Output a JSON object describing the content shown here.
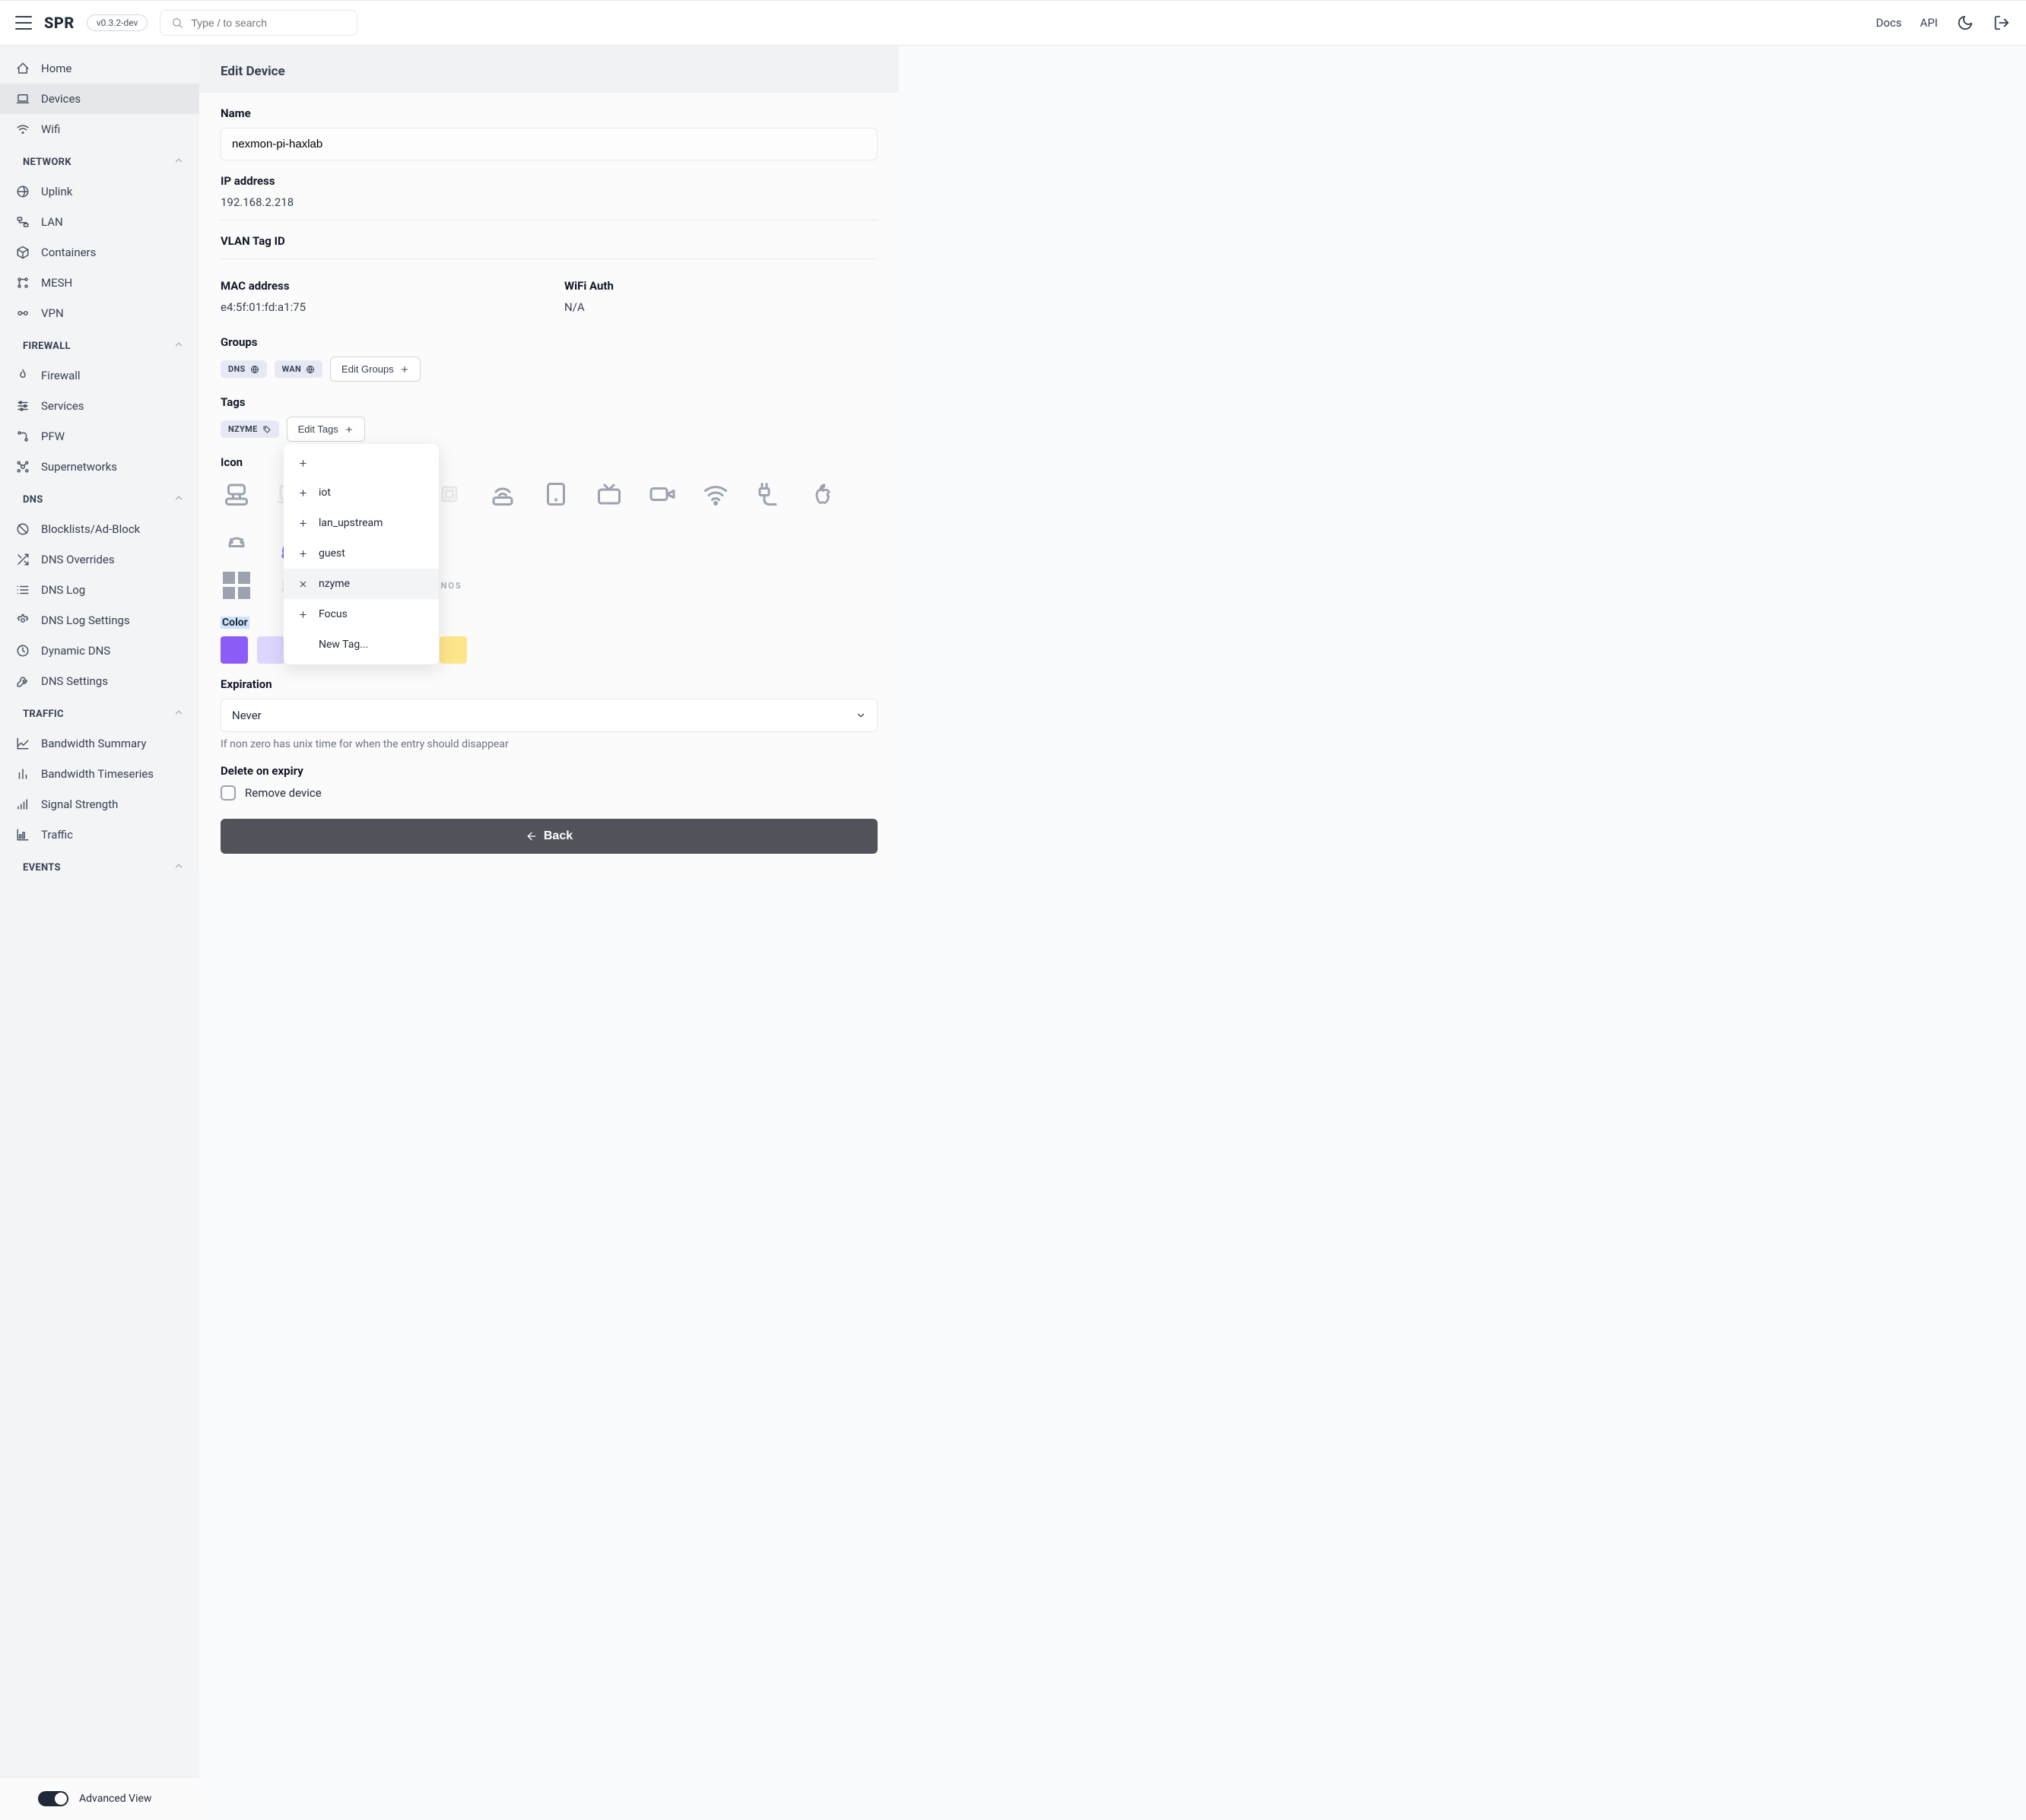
{
  "header": {
    "logo": "SPR",
    "version": "v0.3.2-dev",
    "search_placeholder": "Type / to search",
    "links": {
      "docs": "Docs",
      "api": "API"
    }
  },
  "sidebar": {
    "items_top": [
      {
        "label": "Home",
        "icon": "home"
      },
      {
        "label": "Devices",
        "icon": "laptop",
        "active": true
      },
      {
        "label": "Wifi",
        "icon": "wifi"
      }
    ],
    "sections": [
      {
        "title": "NETWORK",
        "items": [
          {
            "label": "Uplink",
            "icon": "globe"
          },
          {
            "label": "LAN",
            "icon": "lan"
          },
          {
            "label": "Containers",
            "icon": "box"
          },
          {
            "label": "MESH",
            "icon": "mesh"
          },
          {
            "label": "VPN",
            "icon": "vpn"
          }
        ]
      },
      {
        "title": "FIREWALL",
        "items": [
          {
            "label": "Firewall",
            "icon": "flame"
          },
          {
            "label": "Services",
            "icon": "sliders"
          },
          {
            "label": "PFW",
            "icon": "flow"
          },
          {
            "label": "Supernetworks",
            "icon": "net"
          }
        ]
      },
      {
        "title": "DNS",
        "items": [
          {
            "label": "Blocklists/Ad-Block",
            "icon": "ban"
          },
          {
            "label": "DNS Overrides",
            "icon": "shuffle"
          },
          {
            "label": "DNS Log",
            "icon": "list"
          },
          {
            "label": "DNS Log Settings",
            "icon": "gear"
          },
          {
            "label": "Dynamic DNS",
            "icon": "refresh"
          },
          {
            "label": "DNS Settings",
            "icon": "tool"
          }
        ]
      },
      {
        "title": "TRAFFIC",
        "items": [
          {
            "label": "Bandwidth Summary",
            "icon": "chart"
          },
          {
            "label": "Bandwidth Timeseries",
            "icon": "bars"
          },
          {
            "label": "Signal Strength",
            "icon": "signal"
          },
          {
            "label": "Traffic",
            "icon": "barchart"
          }
        ]
      },
      {
        "title": "EVENTS",
        "items": []
      }
    ],
    "advanced_label": "Advanced View"
  },
  "page": {
    "title": "Edit Device",
    "name_label": "Name",
    "name_value": "nexmon-pi-haxlab",
    "ip_label": "IP address",
    "ip_value": "192.168.2.218",
    "vlan_label": "VLAN Tag ID",
    "vlan_value": "",
    "mac_label": "MAC address",
    "mac_value": "e4:5f:01:fd:a1:75",
    "wifi_label": "WiFi Auth",
    "wifi_value": "N/A",
    "groups_label": "Groups",
    "groups": [
      "DNS",
      "WAN"
    ],
    "edit_groups_btn": "Edit Groups",
    "tags_label": "Tags",
    "tags": [
      "NZYME"
    ],
    "edit_tags_btn": "Edit Tags",
    "icon_label": "Icon",
    "brand_text": "ONOS",
    "color_label": "Color",
    "colors": [
      "#8b5cf6",
      "#ddd6fe",
      "#86efac",
      "#5eead4",
      "#93e6f0",
      "#cbd5e1",
      "#fde68a"
    ],
    "expiration_label": "Expiration",
    "expiration_value": "Never",
    "expiration_helper": "If non zero has unix time for when the entry should disappear",
    "delete_label": "Delete on expiry",
    "delete_check_label": "Remove device",
    "back_btn": "Back"
  },
  "tags_dropdown": {
    "items": [
      {
        "label": "",
        "icon": "plus"
      },
      {
        "label": "iot",
        "icon": "plus"
      },
      {
        "label": "lan_upstream",
        "icon": "plus"
      },
      {
        "label": "guest",
        "icon": "plus"
      },
      {
        "label": "nzyme",
        "icon": "x",
        "active": true
      },
      {
        "label": "Focus",
        "icon": "plus"
      },
      {
        "label": "New Tag...",
        "icon": ""
      }
    ]
  }
}
